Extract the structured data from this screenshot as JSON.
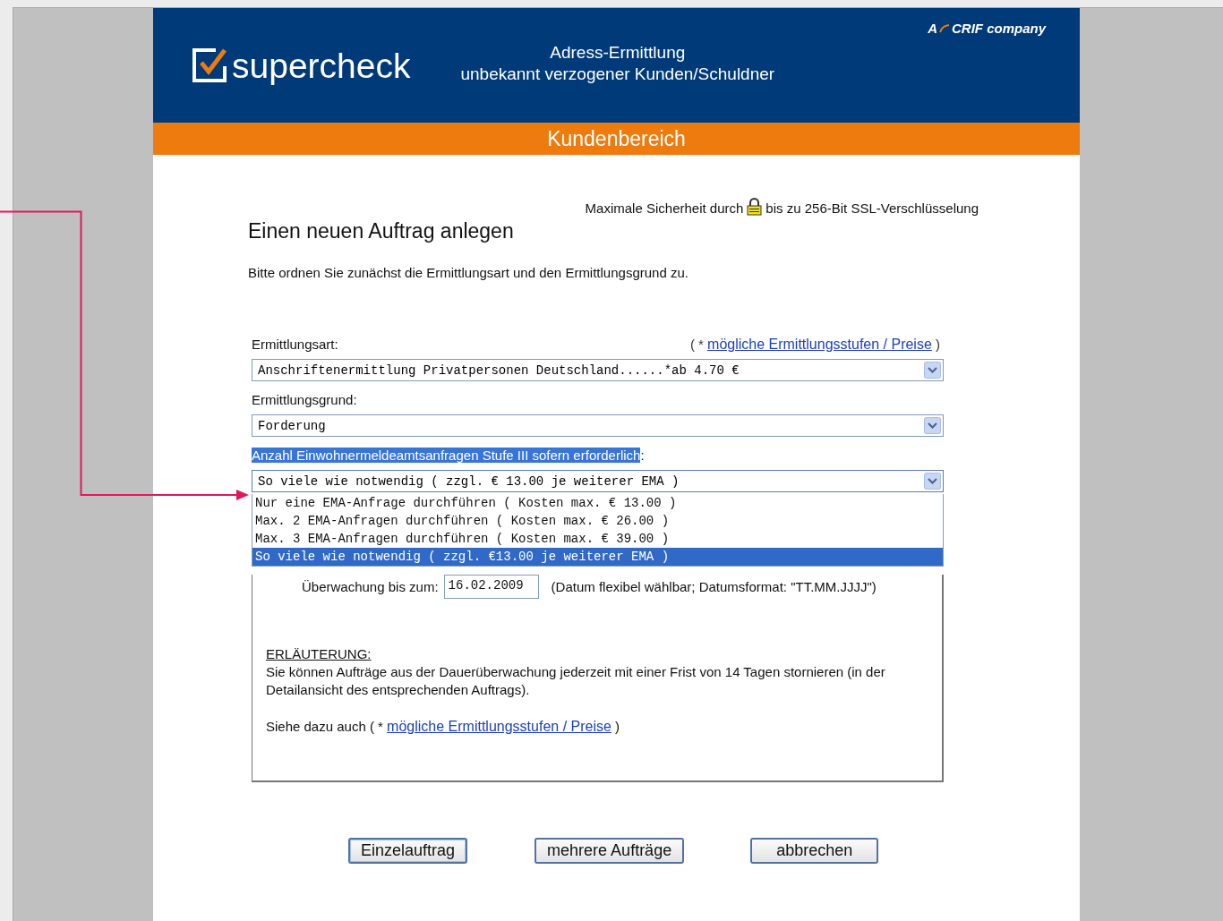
{
  "header": {
    "logo": "supercheck",
    "title_line_1": "Adress-Ermittlung",
    "title_line_2": "unbekannt verzogener Kunden/Schuldner",
    "tagline_prefix": "A",
    "tagline": "CRIF company"
  },
  "section_bar": "Kundenbereich",
  "security_note": {
    "before": "Maximale Sicherheit durch",
    "after": "bis zu 256-Bit SSL-Verschlüsselung"
  },
  "heading": "Einen neuen Auftrag anlegen",
  "intro": "Bitte ordnen Sie zunächst die Ermittlungsart und den Ermittlungsgrund zu.",
  "price_link": {
    "before": "( * ",
    "link": "mögliche Ermittlungsstufen / Preise",
    "after": " )"
  },
  "fields": [
    {
      "label": "Ermittlungsart:",
      "highlighted": false,
      "value": "Anschriftenermittlung Privatpersonen Deutschland......*ab 4.70 €"
    },
    {
      "label": "Ermittlungsgrund:",
      "highlighted": false,
      "value": "Forderung"
    },
    {
      "label": "Anzahl Einwohnermeldeamtsanfragen Stufe III sofern erforderlich",
      "label_suffix": ":",
      "highlighted": true,
      "value": "So viele wie notwendig ( zzgl. € 13.00 je weiterer EMA )",
      "expanded": true,
      "options": [
        {
          "label": "Nur eine EMA-Anfrage durchführen ( Kosten max. € 13.00 )",
          "selected": false
        },
        {
          "label": "Max. 2 EMA-Anfragen durchführen ( Kosten max. € 26.00 )",
          "selected": false
        },
        {
          "label": "Max. 3 EMA-Anfragen durchführen ( Kosten max. € 39.00 )",
          "selected": false
        },
        {
          "label": "So viele wie notwendig ( zzgl. €13.00 je weiterer EMA )",
          "selected": true
        }
      ]
    }
  ],
  "monitoring": {
    "label": "Überwachung bis zum:",
    "value": "16.02.2009",
    "hint": "(Datum flexibel wählbar; Datumsformat: \"TT.MM.JJJJ\")"
  },
  "explanation": {
    "heading": "ERLÄUTERUNG:",
    "text": "Sie können Aufträge aus der Dauerüberwachung jederzeit mit einer Frist von 14 Tagen stornieren (in der Detailansicht des entsprechenden Auftrags).",
    "see_also": "Siehe dazu auch ( * ",
    "link": "mögliche Ermittlungsstufen / Preise",
    "after": " )"
  },
  "buttons": [
    {
      "label": "Einzelauftrag",
      "focused": true
    },
    {
      "label": "mehrere Aufträge",
      "focused": false
    },
    {
      "label": "abbrechen",
      "focused": false
    }
  ]
}
